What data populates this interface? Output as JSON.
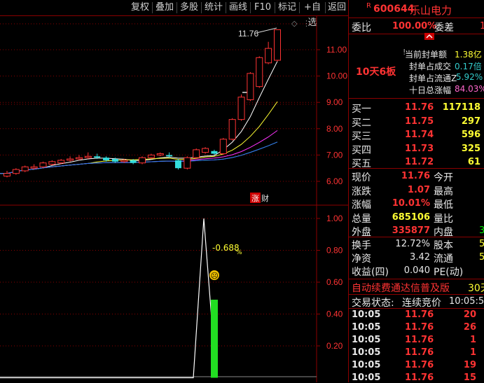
{
  "toolbar": {
    "items": [
      "复权",
      "叠加",
      "多股",
      "统计",
      "画线",
      "F10",
      "标记",
      "+自选",
      "返回"
    ]
  },
  "chart": {
    "price_labels": [
      "11.00",
      "10.00",
      "9.00",
      "8.00",
      "7.00",
      "6.00"
    ],
    "ind_labels": [
      "1.00",
      "0.80",
      "0.60",
      "0.40",
      "0.20"
    ],
    "max_label": "11.76",
    "badge_zhang": "涨",
    "badge_cai": "财",
    "ind_value": "-0.688",
    "ind_unit": "%",
    "face": "☹"
  },
  "chart_data": {
    "type": "line",
    "candles": [
      {
        "o": 6.2,
        "c": 6.3,
        "h": 6.4,
        "l": 6.15
      },
      {
        "o": 6.3,
        "c": 6.45,
        "h": 6.5,
        "l": 6.25
      },
      {
        "o": 6.4,
        "c": 6.55,
        "h": 6.6,
        "l": 6.35
      },
      {
        "o": 6.5,
        "c": 6.55,
        "h": 6.65,
        "l": 6.45
      },
      {
        "o": 6.55,
        "c": 6.7,
        "h": 6.75,
        "l": 6.5
      },
      {
        "o": 6.65,
        "c": 6.75,
        "h": 6.8,
        "l": 6.6
      },
      {
        "o": 6.7,
        "c": 6.8,
        "h": 6.85,
        "l": 6.65
      },
      {
        "o": 6.8,
        "c": 6.85,
        "h": 6.95,
        "l": 6.75
      },
      {
        "o": 6.85,
        "c": 6.9,
        "h": 7.0,
        "l": 6.8
      },
      {
        "o": 6.9,
        "c": 6.95,
        "h": 7.1,
        "l": 6.85
      },
      {
        "o": 6.95,
        "c": 6.9,
        "h": 7.05,
        "l": 6.85
      },
      {
        "o": 6.9,
        "c": 6.8,
        "h": 6.95,
        "l": 6.75
      },
      {
        "o": 6.85,
        "c": 6.75,
        "h": 6.9,
        "l": 6.7
      },
      {
        "o": 6.75,
        "c": 6.8,
        "h": 6.85,
        "l": 6.7
      },
      {
        "o": 6.8,
        "c": 6.7,
        "h": 6.85,
        "l": 6.65
      },
      {
        "o": 6.7,
        "c": 6.9,
        "h": 6.95,
        "l": 6.65
      },
      {
        "o": 6.9,
        "c": 7.0,
        "h": 7.05,
        "l": 6.85
      },
      {
        "o": 7.0,
        "c": 7.05,
        "h": 7.1,
        "l": 6.95
      },
      {
        "o": 7.0,
        "c": 6.95,
        "h": 7.1,
        "l": 6.9
      },
      {
        "o": 6.8,
        "c": 6.5,
        "h": 6.85,
        "l": 6.45
      },
      {
        "o": 6.5,
        "c": 6.9,
        "h": 6.95,
        "l": 6.45
      },
      {
        "o": 6.9,
        "c": 7.2,
        "h": 7.25,
        "l": 6.85
      },
      {
        "o": 7.1,
        "c": 7.25,
        "h": 7.3,
        "l": 7.05
      },
      {
        "o": 7.15,
        "c": 7.05,
        "h": 7.2,
        "l": 7.0
      },
      {
        "o": 7.05,
        "c": 7.6,
        "h": 7.65,
        "l": 7.0
      },
      {
        "o": 7.6,
        "c": 8.35,
        "h": 8.4,
        "l": 7.55
      },
      {
        "o": 8.35,
        "c": 9.2,
        "h": 9.3,
        "l": 8.3
      },
      {
        "o": 9.1,
        "c": 10.1,
        "h": 10.15,
        "l": 9.05
      },
      {
        "o": 9.6,
        "c": 10.7,
        "h": 10.75,
        "l": 9.55
      },
      {
        "o": 10.5,
        "c": 11.05,
        "h": 11.3,
        "l": 10.45
      },
      {
        "o": 10.6,
        "c": 11.76,
        "h": 11.76,
        "l": 10.55
      }
    ],
    "ylim": [
      5.75,
      11.9
    ],
    "indicator": {
      "type": "line",
      "peak": 1.0,
      "bar_value": 0.49,
      "ylim": [
        0,
        1.1
      ]
    }
  },
  "header": {
    "tag": "R",
    "code": "600644",
    "name": "乐山电力"
  },
  "weibi": {
    "label": "委比",
    "value": "100.00%",
    "label2": "委差",
    "value2": "1"
  },
  "limit": {
    "badge": "10天6板",
    "rows": [
      {
        "label": "当前封单额",
        "value": "1.38亿"
      },
      {
        "label": "封单占成交",
        "value": "0.17倍"
      },
      {
        "label": "封单占流通Z",
        "value": "5.92%"
      },
      {
        "label": "十日总涨幅",
        "value": "84.03%"
      }
    ]
  },
  "bids": [
    {
      "label": "买一",
      "price": "11.76",
      "vol": "117118"
    },
    {
      "label": "买二",
      "price": "11.75",
      "vol": "297"
    },
    {
      "label": "买三",
      "price": "11.74",
      "vol": "596"
    },
    {
      "label": "买四",
      "price": "11.73",
      "vol": "325"
    },
    {
      "label": "买五",
      "price": "11.72",
      "vol": "61"
    }
  ],
  "quote": [
    {
      "l": "现价",
      "v": "11.76",
      "l2": "今开",
      "v2": ""
    },
    {
      "l": "涨跌",
      "v": "1.07",
      "l2": "最高",
      "v2": ""
    },
    {
      "l": "涨幅",
      "v": "10.01%",
      "l2": "最低",
      "v2": ""
    },
    {
      "l": "总量",
      "v": "685106",
      "l2": "量比",
      "v2": ""
    },
    {
      "l": "外盘",
      "v": "335877",
      "l2": "内盘",
      "v2": "3"
    }
  ],
  "fund": [
    {
      "l": "换手",
      "v": "12.72%",
      "l2": "股本",
      "v2": "5"
    },
    {
      "l": "净资",
      "v": "3.42",
      "l2": "流通",
      "v2": "5"
    },
    {
      "l": "收益(四)",
      "v": "0.040",
      "l2": "PE(动)",
      "v2": ""
    }
  ],
  "banner": {
    "text": "自动续费通达信普及版",
    "extra": "30天"
  },
  "status": {
    "label": "交易状态:",
    "value": "连续竞价",
    "time": "10:05:5"
  },
  "ticks": [
    {
      "t": "10:05",
      "p": "11.76",
      "v": "20"
    },
    {
      "t": "10:05",
      "p": "11.76",
      "v": "26"
    },
    {
      "t": "10:05",
      "p": "11.76",
      "v": "1"
    },
    {
      "t": "10:05",
      "p": "11.76",
      "v": "1"
    },
    {
      "t": "10:05",
      "p": "11.76",
      "v": "19"
    },
    {
      "t": "10:05",
      "p": "11.76",
      "v": "15"
    }
  ]
}
